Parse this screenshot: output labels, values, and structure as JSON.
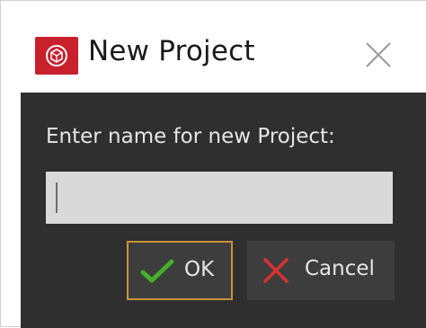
{
  "dialog": {
    "title": "New Project",
    "icons": {
      "app": "app-logo-icon",
      "close": "close-icon"
    },
    "prompt": "Enter name for new Project:",
    "input": {
      "value": "",
      "placeholder": ""
    },
    "buttons": {
      "ok": {
        "label": "OK",
        "icon": "checkmark-icon"
      },
      "cancel": {
        "label": "Cancel",
        "icon": "x-cross-icon"
      }
    }
  },
  "colors": {
    "accent_brand": "#c8202c",
    "ok_check": "#43b02a",
    "cancel_x": "#d9322e",
    "focus_border": "#c9943a",
    "panel": "#2f2f2f"
  }
}
